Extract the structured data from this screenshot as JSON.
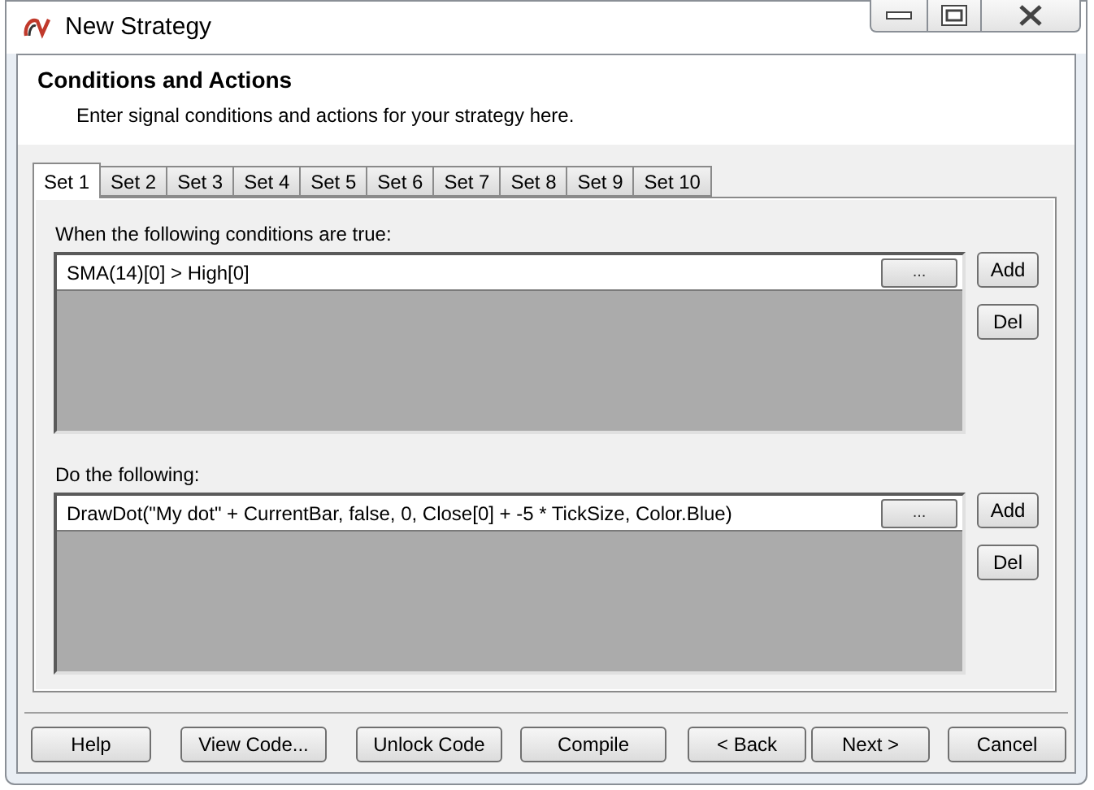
{
  "window": {
    "title": "New Strategy"
  },
  "header": {
    "title": "Conditions and Actions",
    "subtitle": "Enter signal conditions and actions for your strategy here."
  },
  "tabs": [
    {
      "label": "Set 1",
      "selected": true
    },
    {
      "label": "Set 2",
      "selected": false
    },
    {
      "label": "Set 3",
      "selected": false
    },
    {
      "label": "Set 4",
      "selected": false
    },
    {
      "label": "Set 5",
      "selected": false
    },
    {
      "label": "Set 6",
      "selected": false
    },
    {
      "label": "Set 7",
      "selected": false
    },
    {
      "label": "Set 8",
      "selected": false
    },
    {
      "label": "Set 9",
      "selected": false
    },
    {
      "label": "Set 10",
      "selected": false
    }
  ],
  "sections": [
    {
      "label": "When the following conditions are true:",
      "rows": [
        {
          "text": "SMA(14)[0] > High[0]",
          "edit_button": "..."
        }
      ],
      "buttons": [
        "Add",
        "Del"
      ]
    },
    {
      "label": "Do the following:",
      "rows": [
        {
          "text": "DrawDot(\"My dot\" + CurrentBar, false, 0, Close[0] + -5 * TickSize, Color.Blue)",
          "edit_button": "..."
        }
      ],
      "buttons": [
        "Add",
        "Del"
      ]
    }
  ],
  "buttons": [
    "Help",
    "View Code...",
    "Unlock Code",
    "Compile",
    "< Back",
    "Next >",
    "Cancel"
  ]
}
